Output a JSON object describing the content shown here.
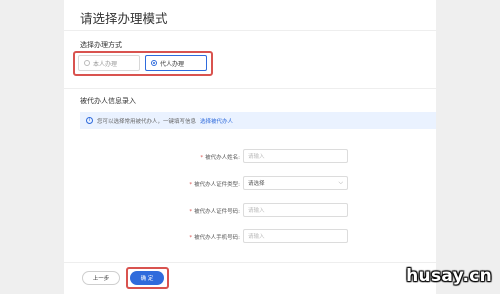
{
  "page": {
    "title": "请选择办理模式"
  },
  "mode_section": {
    "label": "选择办理方式",
    "options": [
      {
        "label": "本人办理",
        "selected": false
      },
      {
        "label": "代人办理",
        "selected": true
      }
    ]
  },
  "agent_section": {
    "label": "被代办人信息录入",
    "info_text": "您可以选择常用被代办人，一键填写信息",
    "info_link": "选择被代办人"
  },
  "form": {
    "fields": [
      {
        "label": "被代办人姓名:",
        "placeholder": "请输入"
      },
      {
        "label": "被代办人证件类型:",
        "value": "请选择"
      },
      {
        "label": "被代办人证件号码:",
        "placeholder": "请输入"
      },
      {
        "label": "被代办人手机号码:",
        "placeholder": "请输入"
      }
    ]
  },
  "actions": {
    "prev": "上一步",
    "confirm": "确 定"
  },
  "watermark": "husay.cn",
  "colors": {
    "accent": "#2f6bdc",
    "highlight": "#d9534f"
  }
}
